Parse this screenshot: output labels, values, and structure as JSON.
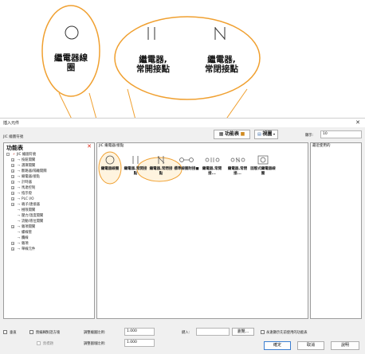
{
  "callouts": [
    {
      "label": "繼電器線\n圈",
      "symbol": "coil-icon"
    },
    {
      "label": "繼電器,\n常開接點",
      "symbol": "normally-open-contact-icon"
    },
    {
      "label": "繼電器,\n常閉接點",
      "symbol": "normally-closed-contact-icon"
    }
  ],
  "colors": {
    "accent": "#f0a030",
    "highlight_fill": "#fff4df"
  },
  "dialog": {
    "title": "插入元件",
    "subtitle": "JIC 繪圖符號",
    "toolbar": {
      "function_table_label": "功能表",
      "view_label": "視圖",
      "display_label": "顯示:",
      "display_value": "10"
    },
    "left_pane": {
      "title": "功能表",
      "items": [
        {
          "label": "JIC 繪圖符號",
          "level": 0,
          "expand": "-"
        },
        {
          "label": "按鈕開關",
          "level": 1,
          "expand": "+"
        },
        {
          "label": "選擇開關",
          "level": 1,
          "expand": "+"
        },
        {
          "label": "斷路器/隔離開關",
          "level": 1,
          "expand": "+"
        },
        {
          "label": "繼電器/接點",
          "level": 1,
          "expand": "+"
        },
        {
          "label": "計時器",
          "level": 1,
          "expand": "+"
        },
        {
          "label": "馬達控制",
          "level": 1,
          "expand": "+"
        },
        {
          "label": "指示燈",
          "level": 1,
          "expand": "+"
        },
        {
          "label": "PLC I/O",
          "level": 1,
          "expand": "+"
        },
        {
          "label": "端子/連接器",
          "level": 1,
          "expand": "+"
        },
        {
          "label": "極限開關",
          "level": 1,
          "expand": ""
        },
        {
          "label": "壓力/溫度開關",
          "level": 1,
          "expand": ""
        },
        {
          "label": "流動/液位開關",
          "level": 1,
          "expand": ""
        },
        {
          "label": "雜項開關",
          "level": 1,
          "expand": "+"
        },
        {
          "label": "螺線管",
          "level": 1,
          "expand": ""
        },
        {
          "label": "纜線",
          "level": 1,
          "expand": ""
        },
        {
          "label": "雜項",
          "level": 1,
          "expand": "+"
        },
        {
          "label": "單線元件",
          "level": 1,
          "expand": "+"
        }
      ]
    },
    "middle_pane": {
      "title": "JIC 繼電器/接點",
      "symbols": [
        {
          "label": "繼電器線圈",
          "glyph": "coil"
        },
        {
          "label": "繼電器,常開接點",
          "glyph": "no"
        },
        {
          "label": "繼電器,常閉接點",
          "glyph": "nc"
        },
        {
          "label": "標準線圈附接■",
          "glyph": "std"
        },
        {
          "label": "繼電器,常開接...",
          "glyph": "no2"
        },
        {
          "label": "繼電器,常閉接...",
          "glyph": "nc2"
        },
        {
          "label": "固態式繼電器線圈",
          "glyph": "ss"
        }
      ]
    },
    "right_pane": {
      "title": "最近使用的"
    },
    "bottom": {
      "vertical_label": "垂直",
      "no_edit_label": "無編輯對話方塊",
      "no_title_label": "無標題",
      "scale_label": "調整繪圖比例:",
      "scale_value": "1.000",
      "block_scale_label": "調整圖塊比例:",
      "block_scale_value": "1.000",
      "type_label": "鍵入:",
      "browse_label": "瀏覽...",
      "keep_label": "永遠顯示先前使用的功能表",
      "ok_label": "確定",
      "cancel_label": "取消",
      "help_label": "說明"
    }
  }
}
